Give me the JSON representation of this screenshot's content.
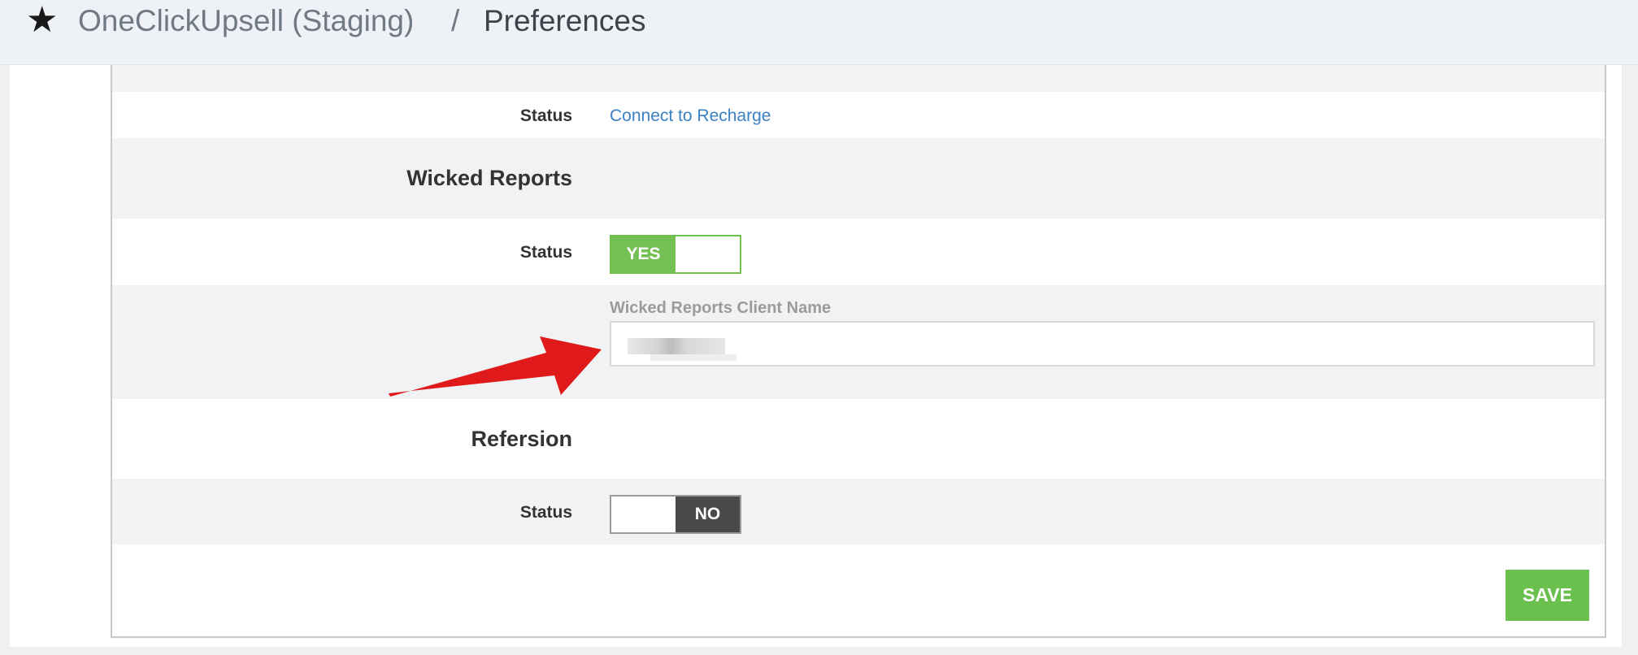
{
  "header": {
    "app_name": "OneClickUpsell (Staging)",
    "separator": "/",
    "page_title": "Preferences"
  },
  "recharge": {
    "status_label": "Status",
    "connect_link": "Connect to Recharge"
  },
  "wicked_reports": {
    "section_title": "Wicked Reports",
    "status_label": "Status",
    "toggle": {
      "on_label": "YES",
      "value": "on"
    },
    "client_name_label": "Wicked Reports Client Name",
    "client_name_value": ""
  },
  "refersion": {
    "section_title": "Refersion",
    "status_label": "Status",
    "toggle": {
      "off_label": "NO",
      "value": "off"
    }
  },
  "actions": {
    "save_label": "SAVE"
  },
  "colors": {
    "accent_green": "#74c054",
    "toggle_off": "#4a4a4a",
    "link_blue": "#3a82c4",
    "annotation_arrow": "#e01a1a"
  }
}
